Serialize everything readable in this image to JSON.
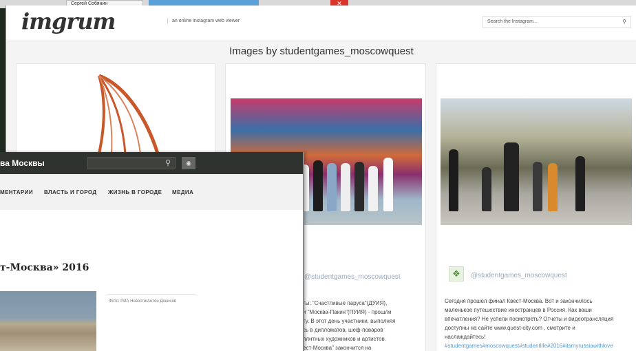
{
  "taskbar": {
    "chip_text": "Сергей Собянин"
  },
  "imgrum": {
    "logo": "imgrum",
    "tagline": "an online instagram web viewer",
    "search_placeholder": "Search the Instagram...",
    "page_title": "Images by studentgames_moscowquest",
    "post2": {
      "username": "@studentgames_moscowquest",
      "caption_lines": [
        "ты: \"Счастливые паруса\"(ДУИЯ),",
        "и \"Москва-Пакин\"(ПУИЯ) - прошли",
        "ту. В этот день участники, выполняя",
        "сь в дипломатов, шеф-поваров",
        "ялнтных художников и артистов.",
        "ест-Москва\" закончится на"
      ]
    },
    "post3": {
      "username": "@studentgames_moscowquest",
      "caption_lines": [
        "Сегодня прошел финал Квест-Москва. Вот и закончилось",
        "маленькое путешествие иностранцев в Россия. Как ваши",
        "впечатления? Не успели посмотреть? Отчеты и видеотрансляция",
        "доступны на сайте www.quest-city.com , смотрите и",
        "наслаждайтесь!"
      ],
      "hashtags": "#studentgames#moscowquest#studentlife#2016#itsmyrussiawithlove"
    }
  },
  "news": {
    "brand": "ва Москвы",
    "nav": [
      "МЕНТАРИИ",
      "ВЛАСТЬ И ГОРОД",
      "ЖИЗНЬ В ГОРОДЕ",
      "МЕДИА"
    ],
    "headline": "т-Москва» 2016",
    "photo_credit": "Фото: РИА Новости/Антон Денисов"
  },
  "colors": {
    "news_header": "#2f332f",
    "hashtag": "#5c9bd1",
    "username": "#99aabb"
  }
}
